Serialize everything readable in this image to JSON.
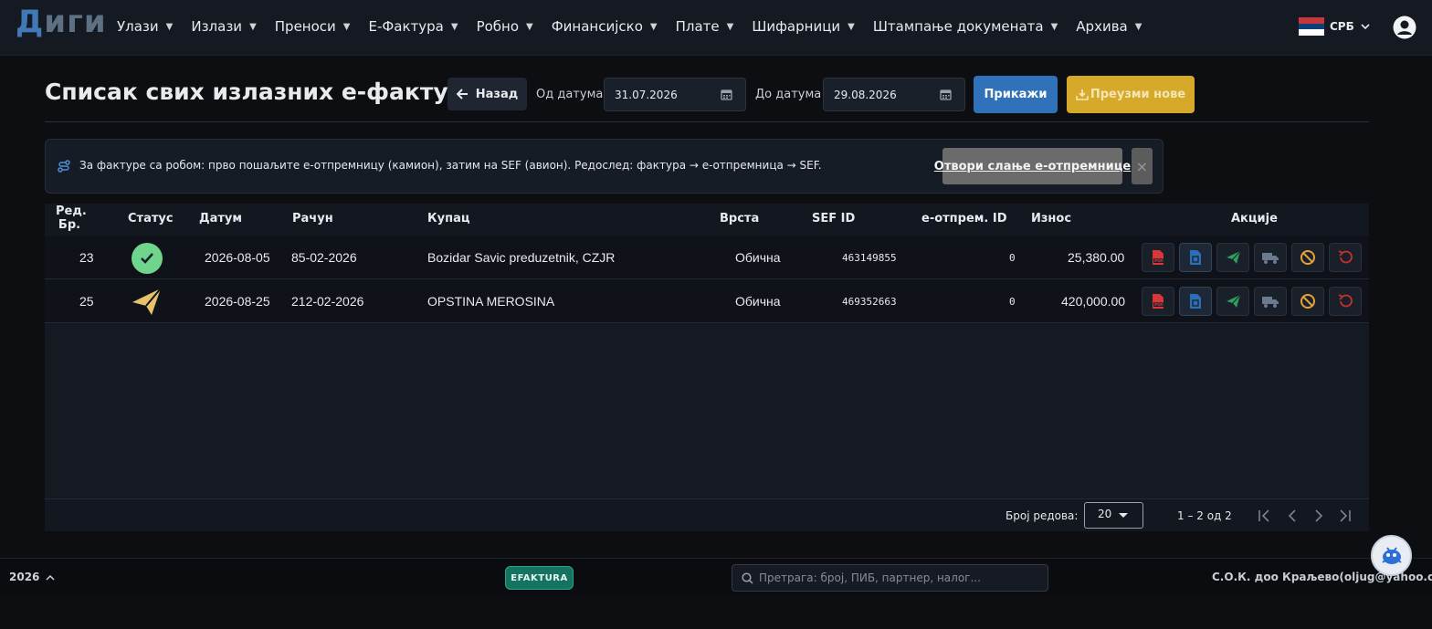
{
  "app": {
    "logo_part1": "Д",
    "logo_part2": "иги",
    "menu": [
      {
        "label": "Улази"
      },
      {
        "label": "Излази"
      },
      {
        "label": "Преноси"
      },
      {
        "label": "Е-Фактура"
      },
      {
        "label": "Робно"
      },
      {
        "label": "Финансијско"
      },
      {
        "label": "Плате"
      },
      {
        "label": "Шифарници"
      },
      {
        "label": "Штампање докумената"
      },
      {
        "label": "Архива"
      }
    ],
    "language": "СРБ"
  },
  "page": {
    "title": "Списак свих излазних е-фактура",
    "back_label": "Назад",
    "from_label": "Од датума",
    "from_value": "31.07.2026",
    "to_label": "До датума",
    "to_value": "29.08.2026",
    "show_label": "Прикажи",
    "download_label": "Преузми нове"
  },
  "banner": {
    "text": "За фактуре са робом: прво пошаљите е-отпремницу (камион), затим на SEF (авион). Редослед: фактура → е-отпремница → SEF.",
    "link_label": "Отвори слање е-отпремнице",
    "close_label": "×"
  },
  "table": {
    "headers": {
      "rb_line1": "Ред.",
      "rb_line2": "Бр.",
      "status": "Статус",
      "date": "Датум",
      "invoice": "Рачун",
      "buyer": "Купац",
      "type": "Врста",
      "sef_id": "SEF ID",
      "dispatch_id": "е-отпрем. ID",
      "amount": "Износ",
      "actions": "Акције"
    },
    "rows": [
      {
        "rb": "23",
        "status": "accepted",
        "date": "2026-08-05",
        "invoice": "85-02-2026",
        "buyer": "Bozidar Savic preduzetnik, CZJR",
        "type": "Обична",
        "sef_id": "463149855",
        "dispatch_id": "0",
        "amount": "25,380.00"
      },
      {
        "rb": "25",
        "status": "sent",
        "date": "2026-08-25",
        "invoice": "212-02-2026",
        "buyer": "OPSTINA MEROSINA",
        "type": "Обична",
        "sef_id": "469352663",
        "dispatch_id": "0",
        "amount": "420,000.00"
      }
    ],
    "action_icons": [
      "pdf-icon",
      "xml-file-icon",
      "send-plane-icon",
      "truck-icon",
      "cancel-icon",
      "storno-icon"
    ],
    "footer": {
      "rows_label": "Број редова:",
      "rows_value": "20",
      "range": "1 – 2 од 2"
    }
  },
  "statusbar": {
    "year": "2026",
    "badge": "EFAKTURA",
    "search_placeholder": "Претрага: број, ПИБ, партнер, налог...",
    "company": "С.О.К. доо Краљево(oljug@yahoo.com)"
  },
  "colors": {
    "primary": "#2f72b9",
    "warning": "#d7a92a",
    "success": "#6fd48c",
    "sent": "#e7c26a",
    "danger": "#d9373a",
    "badge": "#157461"
  }
}
